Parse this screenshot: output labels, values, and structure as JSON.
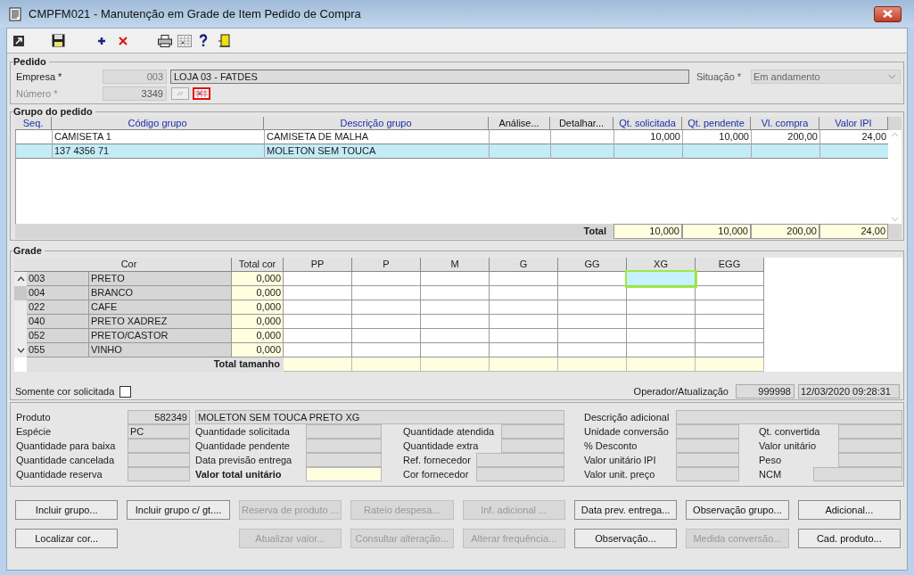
{
  "window": {
    "title": "CMPFM021 - Manutenção em Grade de Item Pedido de Compra"
  },
  "pedido": {
    "title": "Pedido",
    "empresa": {
      "label": "Empresa *",
      "code": "003",
      "name": "LOJA 03 - FATDES"
    },
    "numero": {
      "label": "Número *",
      "value": "3349",
      "disabled": true
    },
    "situacao": {
      "label": "Situação *",
      "value": "Em andamento"
    }
  },
  "grupo": {
    "title": "Grupo do pedido",
    "columns": [
      {
        "label": "Seq.",
        "kind": "data"
      },
      {
        "label": "Código grupo",
        "kind": "data"
      },
      {
        "label": "Descrição grupo",
        "kind": "data"
      },
      {
        "label": "Análise...",
        "kind": "action"
      },
      {
        "label": "Detalhar...",
        "kind": "action"
      },
      {
        "label": "Qt. solicitada",
        "kind": "data"
      },
      {
        "label": "Qt. pendente",
        "kind": "data"
      },
      {
        "label": "Vl. compra",
        "kind": "data"
      },
      {
        "label": "Valor IPI",
        "kind": "data"
      }
    ],
    "rows": [
      {
        "selected": false,
        "codigo": "CAMISETA 1",
        "descricao": "CAMISETA DE MALHA",
        "qt_solicitada": "10,000",
        "qt_pendente": "10,000",
        "vl_compra": "200,00",
        "valor_ipi": "24,00"
      },
      {
        "selected": true,
        "codigo": "137 4356 71",
        "descricao": "MOLETON SEM TOUCA"
      }
    ],
    "total": {
      "label": "Total",
      "values": [
        "10,000",
        "10,000",
        "200,00",
        "24,00"
      ]
    }
  },
  "grade": {
    "title": "Grade",
    "cor_header": "Cor",
    "total_header": "Total cor",
    "sizes": [
      {
        "label": "PP",
        "selected": false
      },
      {
        "label": "P",
        "selected": false
      },
      {
        "label": "M",
        "selected": false
      },
      {
        "label": "G",
        "selected": false
      },
      {
        "label": "GG",
        "selected": false
      },
      {
        "label": "XG",
        "selected": true
      },
      {
        "label": "EGG",
        "selected": false
      }
    ],
    "rows": [
      {
        "code": "003",
        "name": "PRETO",
        "total": "0,000",
        "selected": true
      },
      {
        "code": "004",
        "name": "BRANCO",
        "total": "0,000",
        "selected": false
      },
      {
        "code": "022",
        "name": "CAFE",
        "total": "0,000",
        "selected": false
      },
      {
        "code": "040",
        "name": "PRETO XADREZ",
        "total": "0,000",
        "selected": false
      },
      {
        "code": "052",
        "name": "PRETO/CASTOR",
        "total": "0,000",
        "selected": false
      },
      {
        "code": "055",
        "name": "VINHO",
        "total": "0,000",
        "selected": false
      }
    ],
    "total_label": "Total tamanho",
    "somente": {
      "label": "Somente cor solicitada",
      "checked": false
    },
    "operador": {
      "label": "Operador/Atualização",
      "code": "999998",
      "timestamp": "12/03/2020 09:28:31"
    }
  },
  "detalhe": {
    "produto": {
      "label": "Produto",
      "code": "582349",
      "description": "MOLETON SEM TOUCA PRETO XG"
    },
    "adicional": {
      "label": "Descrição adicional"
    },
    "rows": [
      [
        {
          "kind": "text",
          "label": "Espécie",
          "value": "PC"
        },
        {
          "kind": "field",
          "label": "Quantidade solicitada"
        },
        {
          "kind": "field",
          "label": "Quantidade atendida"
        },
        {
          "kind": "field",
          "label": "Unidade conversão"
        },
        {
          "kind": "field",
          "label": "Qt. convertida"
        }
      ],
      [
        {
          "kind": "field",
          "label": "Quantidade para baixa"
        },
        {
          "kind": "field",
          "label": "Quantidade pendente"
        },
        {
          "kind": "field",
          "label": "Quantidade extra"
        },
        {
          "kind": "field",
          "label": "% Desconto"
        },
        {
          "kind": "field",
          "label": "Valor unitário"
        }
      ],
      [
        {
          "kind": "field",
          "label": "Quantidade cancelada"
        },
        {
          "kind": "field",
          "label": "Data previsão entrega"
        },
        {
          "kind": "wide",
          "label": "Ref. fornecedor"
        },
        {
          "kind": "field",
          "label": "Valor unitário IPI"
        },
        {
          "kind": "field",
          "label": "Peso"
        }
      ],
      [
        {
          "kind": "field",
          "label": "Quantidade reserva"
        },
        {
          "kind": "total",
          "label": "Valor total unitário"
        },
        {
          "kind": "wide",
          "label": "Cor fornecedor"
        },
        {
          "kind": "field",
          "label": "Valor unit. preço"
        },
        {
          "kind": "wide",
          "label": "NCM"
        }
      ]
    ]
  },
  "buttons": [
    [
      {
        "label": "Incluir grupo...",
        "disabled": false
      },
      {
        "label": "Incluir grupo c/ gt....",
        "disabled": false
      },
      {
        "label": "Reserva de produto ...",
        "disabled": true
      },
      {
        "label": "Rateio despesa...",
        "disabled": true
      },
      {
        "label": "Inf. adicional ...",
        "disabled": true
      },
      {
        "label": "Data prev. entrega...",
        "disabled": false
      },
      {
        "label": "Observação grupo...",
        "disabled": false
      },
      {
        "label": "Adicional...",
        "disabled": false
      }
    ],
    [
      {
        "label": "Localizar cor...",
        "disabled": false
      },
      {
        "label": "Atualizar valor...",
        "disabled": true
      },
      {
        "label": "Consultar alteração...",
        "disabled": true
      },
      {
        "label": "Alterar frequência...",
        "disabled": true
      },
      {
        "label": "Observação...",
        "disabled": false
      },
      {
        "label": "Medida conversão...",
        "disabled": true
      },
      {
        "label": "Cad. produto...",
        "disabled": false
      }
    ]
  ]
}
